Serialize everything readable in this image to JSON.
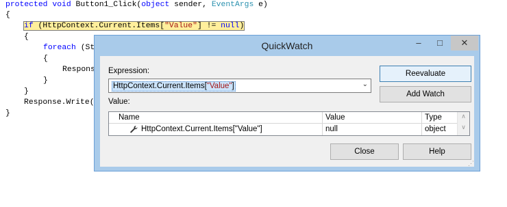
{
  "code": {
    "line1_kw1": "protected",
    "line1_kw2": "void",
    "line1_name": " Button1_Click(",
    "line1_kw3": "object",
    "line1_sender": " sender, ",
    "line1_type": "EventArgs",
    "line1_end": " e)",
    "line2": "{",
    "line3_kw": "if",
    "line3_pre": " (HttpContext.Current.Items[",
    "line3_str": "\"Value\"",
    "line3_mid": "] != ",
    "line3_kw2": "null",
    "line3_end": ")",
    "line4": "{",
    "line5_kw": "foreach",
    "line5_rest": " (St",
    "line6": "{",
    "line7": "Respons",
    "line8": "}",
    "line9": "}",
    "line10": "Response.Write(",
    "line11": "}"
  },
  "dialog": {
    "title": "QuickWatch",
    "min_glyph": "–",
    "max_glyph": "□",
    "close_glyph": "✕",
    "expression_label": "Expression:",
    "expression_prefix": "HttpContext.Current.Items[",
    "expression_string": "\"Value\"",
    "expression_suffix": "]",
    "dropdown_glyph": "⌄",
    "value_label": "Value:",
    "reevaluate": "Reevaluate",
    "add_watch": "Add Watch",
    "close": "Close",
    "help": "Help",
    "columns": [
      "Name",
      "Value",
      "Type"
    ],
    "row": {
      "name": "HttpContext.Current.Items[\"Value\"]",
      "value": "null",
      "type": "object",
      "icon": "wrench-icon"
    },
    "scroll_up_glyph": "∧",
    "scroll_down_glyph": "∨",
    "grip_glyph": "⋰"
  },
  "colors": {
    "keyword": "#0000ff",
    "type": "#2b91af",
    "string": "#a31515",
    "highlight": "#ffef9c",
    "dialog_frame": "#a9cbea"
  }
}
